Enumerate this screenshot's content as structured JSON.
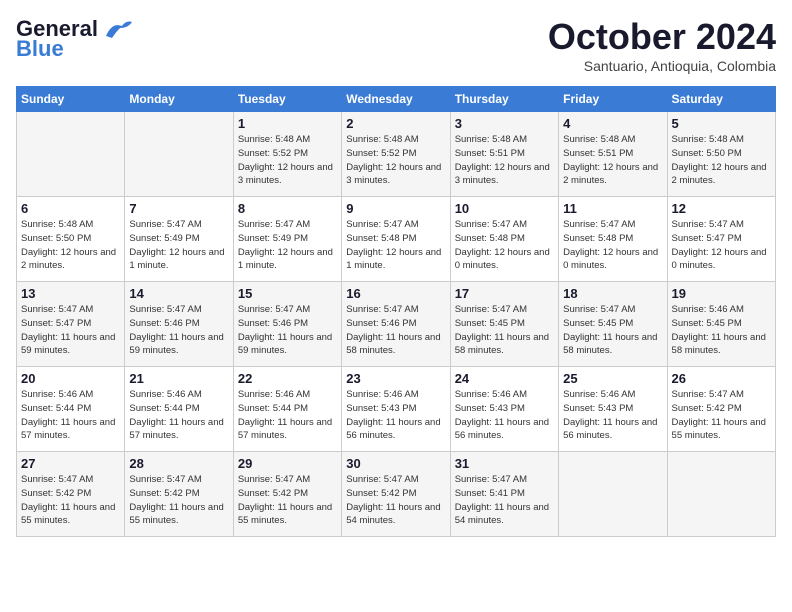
{
  "header": {
    "logo_line1": "General",
    "logo_line2": "Blue",
    "month": "October 2024",
    "location": "Santuario, Antioquia, Colombia"
  },
  "weekdays": [
    "Sunday",
    "Monday",
    "Tuesday",
    "Wednesday",
    "Thursday",
    "Friday",
    "Saturday"
  ],
  "weeks": [
    [
      {
        "day": "",
        "info": ""
      },
      {
        "day": "",
        "info": ""
      },
      {
        "day": "1",
        "info": "Sunrise: 5:48 AM\nSunset: 5:52 PM\nDaylight: 12 hours and 3 minutes."
      },
      {
        "day": "2",
        "info": "Sunrise: 5:48 AM\nSunset: 5:52 PM\nDaylight: 12 hours and 3 minutes."
      },
      {
        "day": "3",
        "info": "Sunrise: 5:48 AM\nSunset: 5:51 PM\nDaylight: 12 hours and 3 minutes."
      },
      {
        "day": "4",
        "info": "Sunrise: 5:48 AM\nSunset: 5:51 PM\nDaylight: 12 hours and 2 minutes."
      },
      {
        "day": "5",
        "info": "Sunrise: 5:48 AM\nSunset: 5:50 PM\nDaylight: 12 hours and 2 minutes."
      }
    ],
    [
      {
        "day": "6",
        "info": "Sunrise: 5:48 AM\nSunset: 5:50 PM\nDaylight: 12 hours and 2 minutes."
      },
      {
        "day": "7",
        "info": "Sunrise: 5:47 AM\nSunset: 5:49 PM\nDaylight: 12 hours and 1 minute."
      },
      {
        "day": "8",
        "info": "Sunrise: 5:47 AM\nSunset: 5:49 PM\nDaylight: 12 hours and 1 minute."
      },
      {
        "day": "9",
        "info": "Sunrise: 5:47 AM\nSunset: 5:48 PM\nDaylight: 12 hours and 1 minute."
      },
      {
        "day": "10",
        "info": "Sunrise: 5:47 AM\nSunset: 5:48 PM\nDaylight: 12 hours and 0 minutes."
      },
      {
        "day": "11",
        "info": "Sunrise: 5:47 AM\nSunset: 5:48 PM\nDaylight: 12 hours and 0 minutes."
      },
      {
        "day": "12",
        "info": "Sunrise: 5:47 AM\nSunset: 5:47 PM\nDaylight: 12 hours and 0 minutes."
      }
    ],
    [
      {
        "day": "13",
        "info": "Sunrise: 5:47 AM\nSunset: 5:47 PM\nDaylight: 11 hours and 59 minutes."
      },
      {
        "day": "14",
        "info": "Sunrise: 5:47 AM\nSunset: 5:46 PM\nDaylight: 11 hours and 59 minutes."
      },
      {
        "day": "15",
        "info": "Sunrise: 5:47 AM\nSunset: 5:46 PM\nDaylight: 11 hours and 59 minutes."
      },
      {
        "day": "16",
        "info": "Sunrise: 5:47 AM\nSunset: 5:46 PM\nDaylight: 11 hours and 58 minutes."
      },
      {
        "day": "17",
        "info": "Sunrise: 5:47 AM\nSunset: 5:45 PM\nDaylight: 11 hours and 58 minutes."
      },
      {
        "day": "18",
        "info": "Sunrise: 5:47 AM\nSunset: 5:45 PM\nDaylight: 11 hours and 58 minutes."
      },
      {
        "day": "19",
        "info": "Sunrise: 5:46 AM\nSunset: 5:45 PM\nDaylight: 11 hours and 58 minutes."
      }
    ],
    [
      {
        "day": "20",
        "info": "Sunrise: 5:46 AM\nSunset: 5:44 PM\nDaylight: 11 hours and 57 minutes."
      },
      {
        "day": "21",
        "info": "Sunrise: 5:46 AM\nSunset: 5:44 PM\nDaylight: 11 hours and 57 minutes."
      },
      {
        "day": "22",
        "info": "Sunrise: 5:46 AM\nSunset: 5:44 PM\nDaylight: 11 hours and 57 minutes."
      },
      {
        "day": "23",
        "info": "Sunrise: 5:46 AM\nSunset: 5:43 PM\nDaylight: 11 hours and 56 minutes."
      },
      {
        "day": "24",
        "info": "Sunrise: 5:46 AM\nSunset: 5:43 PM\nDaylight: 11 hours and 56 minutes."
      },
      {
        "day": "25",
        "info": "Sunrise: 5:46 AM\nSunset: 5:43 PM\nDaylight: 11 hours and 56 minutes."
      },
      {
        "day": "26",
        "info": "Sunrise: 5:47 AM\nSunset: 5:42 PM\nDaylight: 11 hours and 55 minutes."
      }
    ],
    [
      {
        "day": "27",
        "info": "Sunrise: 5:47 AM\nSunset: 5:42 PM\nDaylight: 11 hours and 55 minutes."
      },
      {
        "day": "28",
        "info": "Sunrise: 5:47 AM\nSunset: 5:42 PM\nDaylight: 11 hours and 55 minutes."
      },
      {
        "day": "29",
        "info": "Sunrise: 5:47 AM\nSunset: 5:42 PM\nDaylight: 11 hours and 55 minutes."
      },
      {
        "day": "30",
        "info": "Sunrise: 5:47 AM\nSunset: 5:42 PM\nDaylight: 11 hours and 54 minutes."
      },
      {
        "day": "31",
        "info": "Sunrise: 5:47 AM\nSunset: 5:41 PM\nDaylight: 11 hours and 54 minutes."
      },
      {
        "day": "",
        "info": ""
      },
      {
        "day": "",
        "info": ""
      }
    ]
  ]
}
